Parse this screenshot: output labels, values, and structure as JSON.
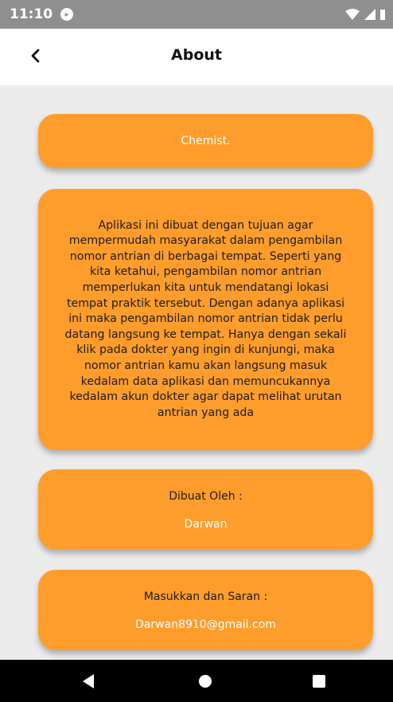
{
  "status_bar": {
    "time": "11:10",
    "notification_icon": "circle-notification-icon",
    "wifi_icon": "wifi-icon",
    "signal_icon": "signal-icon",
    "battery_icon": "battery-icon"
  },
  "app_bar": {
    "title": "About",
    "back_icon": "back-arrow-icon"
  },
  "cards": {
    "app_name": "Chemist.",
    "description": "Aplikasi ini dibuat dengan tujuan agar mempermudah masyarakat dalam pengambilan nomor antrian di berbagai tempat. Seperti yang kita ketahui, pengambilan nomor antrian memperlukan kita untuk mendatangi lokasi tempat praktik tersebut. Dengan adanya aplikasi ini maka pengambilan nomor antrian tidak perlu datang langsung ke tempat. Hanya dengan sekali klik pada dokter yang ingin di kunjungi, maka nomor antrian kamu akan langsung masuk kedalam data aplikasi dan memuncukannya kedalam akun dokter agar dapat melihat urutan antrian yang ada",
    "author_label": "Dibuat Oleh :",
    "author_name": "Darwan",
    "contact_label": "Masukkan dan Saran :",
    "contact_email": "Darwan8910@gmail.com"
  },
  "nav_bar": {
    "back": "nav-back-icon",
    "home": "nav-home-icon",
    "recents": "nav-recents-icon"
  },
  "colors": {
    "card": "#fe9d2c",
    "background": "#ebebeb",
    "status_bar": "#8f8f8f"
  }
}
